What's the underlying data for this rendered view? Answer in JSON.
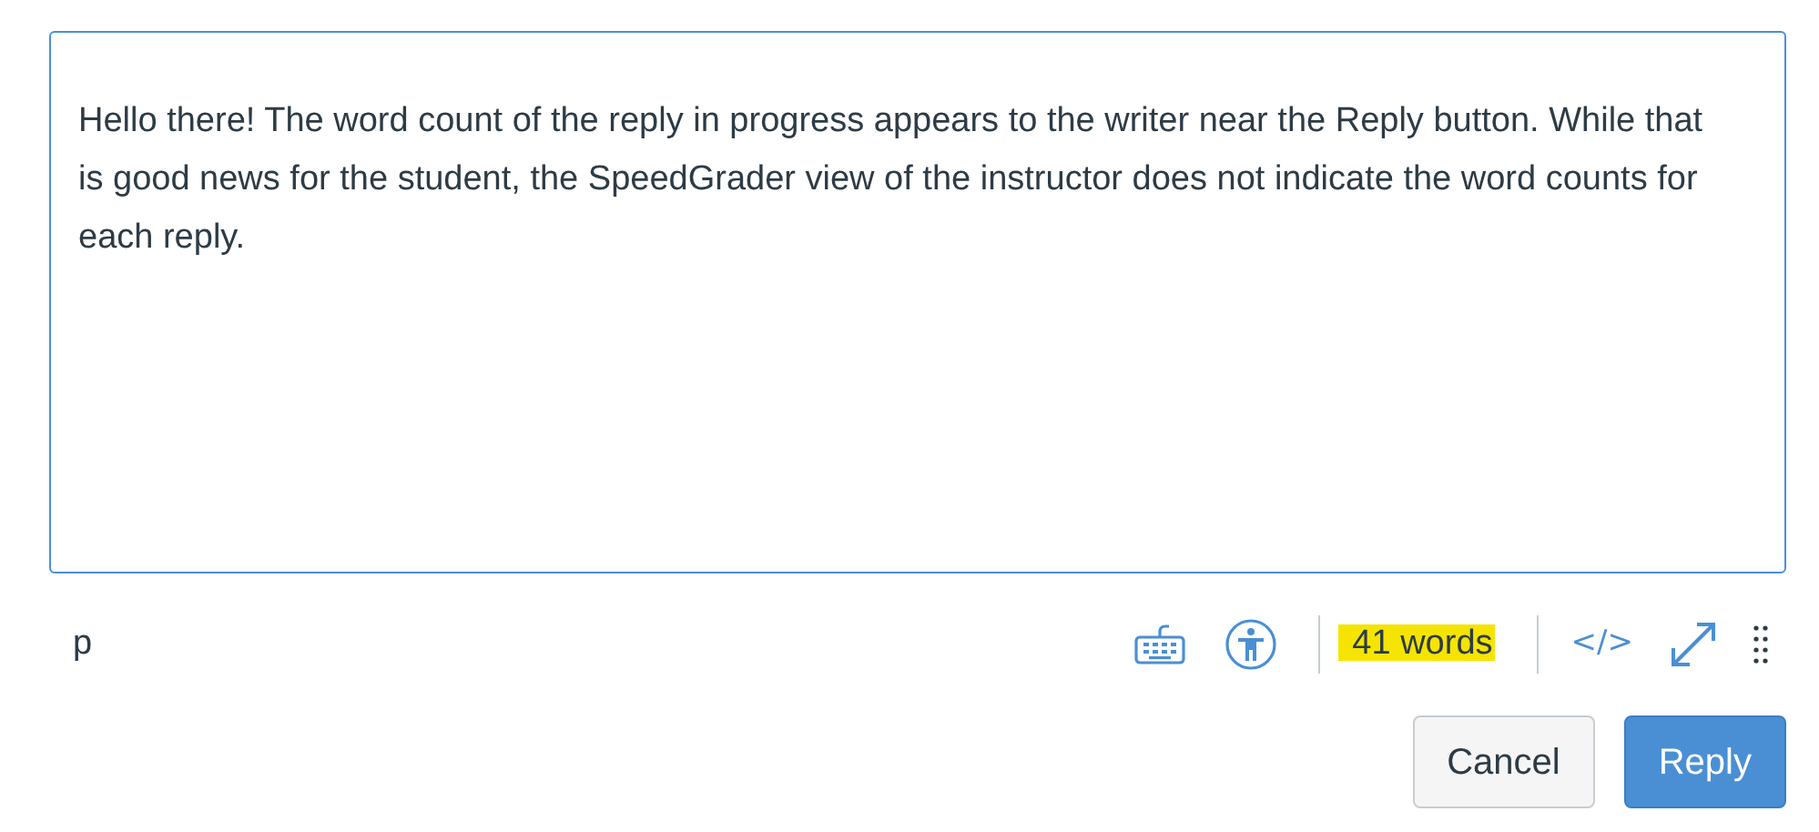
{
  "editor": {
    "text": "Hello there! The word count of the reply in progress appears to the writer near the Reply button. While that is good news for the student, the SpeedGrader view of the instructor does not indicate the word counts for each reply."
  },
  "status_bar": {
    "path": "p",
    "word_count": "41 words",
    "word_count_highlighted": true,
    "html_toggle": "</>"
  },
  "buttons": [
    {
      "label": "Cancel",
      "kind": "secondary"
    },
    {
      "label": "Reply",
      "kind": "primary"
    }
  ]
}
